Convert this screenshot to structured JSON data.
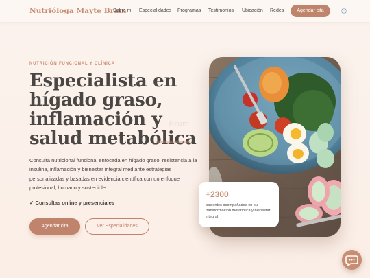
{
  "brand": "Nutrióloga Mayte Bram",
  "nav": {
    "links": [
      "Sobre mí",
      "Especialidades",
      "Programas",
      "Testimonios",
      "Ubicación",
      "Redes"
    ],
    "cta": "Agendar cita",
    "settings_icon": "gear-icon"
  },
  "hero": {
    "eyebrow": "NUTRICIÓN FUNCIONAL Y CLÍNICA",
    "headline": "Especialista en hígado graso, inflamación y salud metabólica",
    "watermark": "Bram",
    "description": "Consulta nutricional funcional enfocada en hígado graso, resistencia a la insulina, inflamación y bienestar integral mediante estrategias personalizadas y basadas en evidencia científica con un enfoque profesional, humano y sostenible.",
    "check": "✓ Consultas online y presenciales",
    "primary_button": "Agendar cita",
    "secondary_button": "Ver Especialidades"
  },
  "stat": {
    "value": "+2300",
    "label": "pacientes acompañados en su transformación metabólica y bienestar integral."
  },
  "chat": {
    "icon": "chat-icon"
  },
  "colors": {
    "accent": "#c0836b",
    "brand": "#c98d72",
    "text": "#4a4644"
  }
}
